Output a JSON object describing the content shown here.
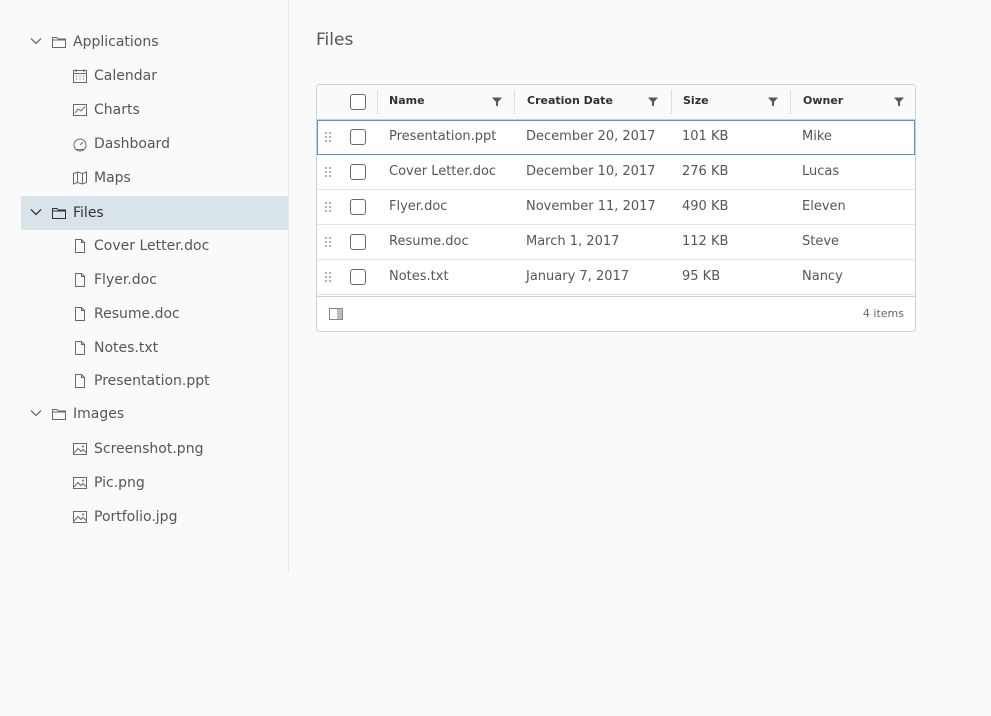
{
  "sidebar": {
    "tree": [
      {
        "label": "Applications",
        "icon": "folder-icon",
        "level": 1,
        "expanded": true
      },
      {
        "label": "Calendar",
        "icon": "calendar-icon",
        "level": 2
      },
      {
        "label": "Charts",
        "icon": "line-chart-icon",
        "level": 2
      },
      {
        "label": "Dashboard",
        "icon": "dashboard-icon",
        "level": 2
      },
      {
        "label": "Maps",
        "icon": "map-icon",
        "level": 2
      },
      {
        "label": "Files",
        "icon": "folder-icon",
        "level": 1,
        "expanded": true,
        "selected": true
      },
      {
        "label": "Cover Letter.doc",
        "icon": "file-icon",
        "level": 2
      },
      {
        "label": "Flyer.doc",
        "icon": "file-icon",
        "level": 2
      },
      {
        "label": "Resume.doc",
        "icon": "file-icon",
        "level": 2
      },
      {
        "label": "Notes.txt",
        "icon": "file-icon",
        "level": 2
      },
      {
        "label": "Presentation.ppt",
        "icon": "file-icon",
        "level": 2
      },
      {
        "label": "Images",
        "icon": "folder-icon",
        "level": 1,
        "expanded": true
      },
      {
        "label": "Screenshot.png",
        "icon": "image-icon",
        "level": 2
      },
      {
        "label": "Pic.png",
        "icon": "image-icon",
        "level": 2
      },
      {
        "label": "Portfolio.jpg",
        "icon": "image-icon",
        "level": 2
      }
    ]
  },
  "main": {
    "title": "Files",
    "grid": {
      "columns": [
        {
          "label": "Name"
        },
        {
          "label": "Creation Date"
        },
        {
          "label": "Size"
        },
        {
          "label": "Owner"
        }
      ],
      "rows": [
        {
          "name": "Presentation.ppt",
          "date": "December 20, 2017",
          "size": "101 KB",
          "owner": "Mike",
          "active": true
        },
        {
          "name": "Cover Letter.doc",
          "date": "December 10, 2017",
          "size": "276 KB",
          "owner": "Lucas"
        },
        {
          "name": "Flyer.doc",
          "date": "November 11, 2017",
          "size": "490 KB",
          "owner": "Eleven"
        },
        {
          "name": "Resume.doc",
          "date": "March 1, 2017",
          "size": "112 KB",
          "owner": "Steve"
        },
        {
          "name": "Notes.txt",
          "date": "January 7, 2017",
          "size": "95 KB",
          "owner": "Nancy"
        }
      ],
      "footer_count": "4 items"
    }
  },
  "colors": {
    "selected_bg": "#d9e4ea",
    "active_row_outline": "#4d94e3",
    "icon": "#6a6a6a"
  }
}
